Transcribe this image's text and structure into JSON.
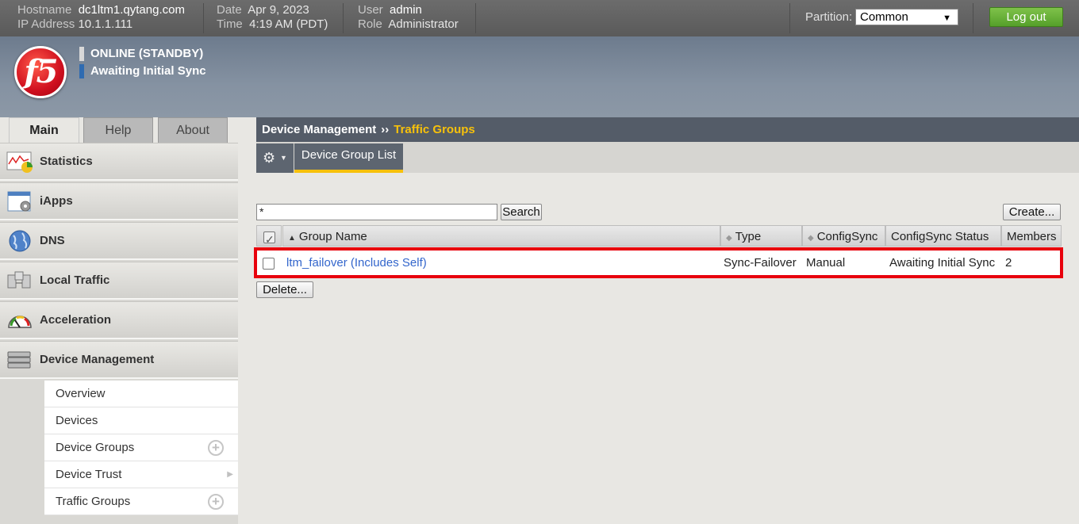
{
  "topbar": {
    "hostname_label": "Hostname",
    "hostname": "dc1ltm1.qytang.com",
    "ip_label": "IP Address",
    "ip": "10.1.1.111",
    "date_label": "Date",
    "date": "Apr 9, 2023",
    "time_label": "Time",
    "time": "4:19 AM (PDT)",
    "user_label": "User",
    "user": "admin",
    "role_label": "Role",
    "role": "Administrator",
    "partition_label": "Partition:",
    "partition_value": "Common",
    "logout_label": "Log out"
  },
  "banner": {
    "logo_text": "f5",
    "status_online": "ONLINE (STANDBY)",
    "status_sync": "Awaiting Initial Sync",
    "status_online_color": "#d8d8d8",
    "status_sync_color": "#2f6bb1"
  },
  "main_tabs": [
    "Main",
    "Help",
    "About"
  ],
  "sidebar": {
    "items": [
      {
        "label": "Statistics",
        "icon": "statistics-icon"
      },
      {
        "label": "iApps",
        "icon": "iapps-icon"
      },
      {
        "label": "DNS",
        "icon": "globe-icon"
      },
      {
        "label": "Local Traffic",
        "icon": "local-traffic-icon"
      },
      {
        "label": "Acceleration",
        "icon": "gauge-icon"
      },
      {
        "label": "Device Management",
        "icon": "server-icon"
      }
    ],
    "submenu": [
      "Overview",
      "Devices",
      "Device Groups",
      "Device Trust",
      "Traffic Groups"
    ]
  },
  "breadcrumb": {
    "parent": "Device Management",
    "separator": "››",
    "current": "Traffic Groups"
  },
  "subtab": {
    "label": "Device Group List"
  },
  "search": {
    "value": "*",
    "button": "Search"
  },
  "buttons": {
    "create": "Create...",
    "delete": "Delete..."
  },
  "table": {
    "headers": [
      "Group Name",
      "Type",
      "ConfigSync",
      "ConfigSync Status",
      "Members"
    ],
    "rows": [
      {
        "name": "ltm_failover (Includes Self)",
        "type": "Sync-Failover",
        "configsync": "Manual",
        "status": "Awaiting Initial Sync",
        "members": "2"
      }
    ]
  },
  "colors": {
    "accent_yellow": "#f7c10b",
    "highlight_red": "#e8000c",
    "logout_green": "#66b032"
  }
}
